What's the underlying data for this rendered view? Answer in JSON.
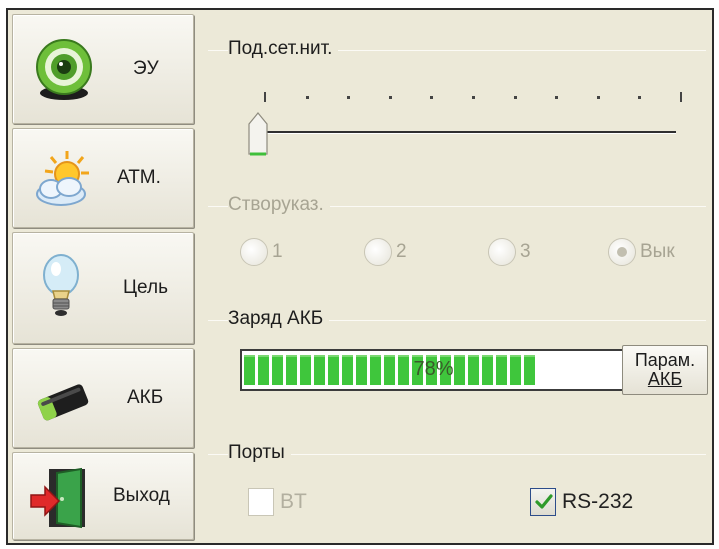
{
  "nav": {
    "eu": {
      "label": "ЭУ",
      "icon": "target-icon"
    },
    "atm": {
      "label": "АТМ.",
      "icon": "weather-sun-cloud-icon"
    },
    "cel": {
      "label": "Цель",
      "icon": "light-bulb-icon"
    },
    "akb": {
      "label": "АКБ",
      "icon": "battery-icon"
    },
    "exit": {
      "label": "Выход",
      "icon": "exit-door-icon"
    }
  },
  "slider": {
    "title": "Под.сет.нит.",
    "tick_count": 11,
    "value_index": 0
  },
  "stvor": {
    "title": "Створуказ.",
    "options": [
      "1",
      "2",
      "3",
      "Вык"
    ],
    "selected": "Вык",
    "enabled": false
  },
  "battery": {
    "title": "Заряд АКБ",
    "percent": 78,
    "percent_label": "78%",
    "param_button_line1": "Парам.",
    "param_button_line2": "АКБ"
  },
  "ports": {
    "title": "Порты",
    "bt": {
      "label": "BT",
      "checked": false,
      "enabled": false
    },
    "rs232": {
      "label": "RS-232",
      "checked": true,
      "enabled": true
    }
  },
  "colors": {
    "progress_fill": "#3fc63c",
    "check_mark": "#2e9a2a",
    "window_bg": "#ece9d8"
  }
}
